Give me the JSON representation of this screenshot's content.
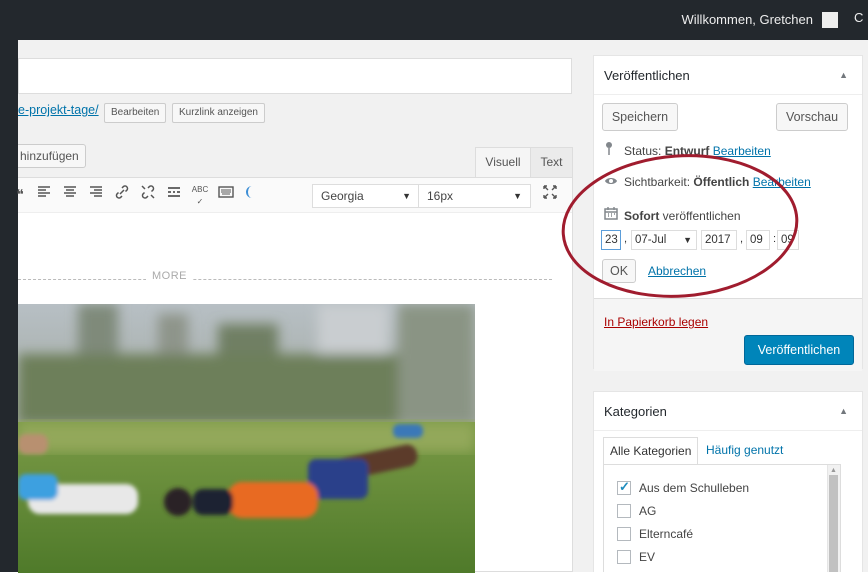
{
  "admin_bar": {
    "welcome": "Willkommen, Gretchen",
    "right_letter": "C"
  },
  "permalink": {
    "slug": "e-projekt-tage/",
    "edit_label": "Bearbeiten",
    "shortlink_label": "Kurzlink anzeigen"
  },
  "editor": {
    "media_button": "hinzufügen",
    "tabs": {
      "visual": "Visuell",
      "text": "Text"
    },
    "font_family": "Georgia",
    "font_size": "16px",
    "more_label": "MORE",
    "toolbar_icons": [
      "blockquote-icon",
      "align-left-icon",
      "align-center-icon",
      "align-right-icon",
      "link-icon",
      "unlink-icon",
      "read-more-icon",
      "spellcheck-icon",
      "keyboard-icon",
      "distraction-free-icon",
      "fullscreen-icon"
    ]
  },
  "publish": {
    "title": "Veröffentlichen",
    "save_label": "Speichern",
    "preview_label": "Vorschau",
    "status_label": "Status:",
    "status_value": "Entwurf",
    "status_edit": "Bearbeiten",
    "visibility_label": "Sichtbarkeit:",
    "visibility_value": "Öffentlich",
    "visibility_edit": "Bearbeiten",
    "schedule_bold": "Sofort",
    "schedule_text": "veröffentlichen",
    "date": {
      "day": "23",
      "month": "07-Jul",
      "year": "2017",
      "hour": "09",
      "minute": "09"
    },
    "ok_label": "OK",
    "cancel_label": "Abbrechen",
    "trash_label": "In Papierkorb legen",
    "publish_label": "Veröffentlichen",
    "highlight_color": "#a01c2e"
  },
  "categories": {
    "title": "Kategorien",
    "tab_all": "Alle Kategorien",
    "tab_popular": "Häufig genutzt",
    "items": [
      {
        "label": "Aus dem Schulleben",
        "checked": true
      },
      {
        "label": "AG",
        "checked": false
      },
      {
        "label": "Elterncafé",
        "checked": false
      },
      {
        "label": "EV",
        "checked": false
      }
    ]
  },
  "colors": {
    "admin_bar": "#23282d",
    "link": "#0073aa",
    "primary": "#0085ba",
    "trash": "#a00"
  }
}
